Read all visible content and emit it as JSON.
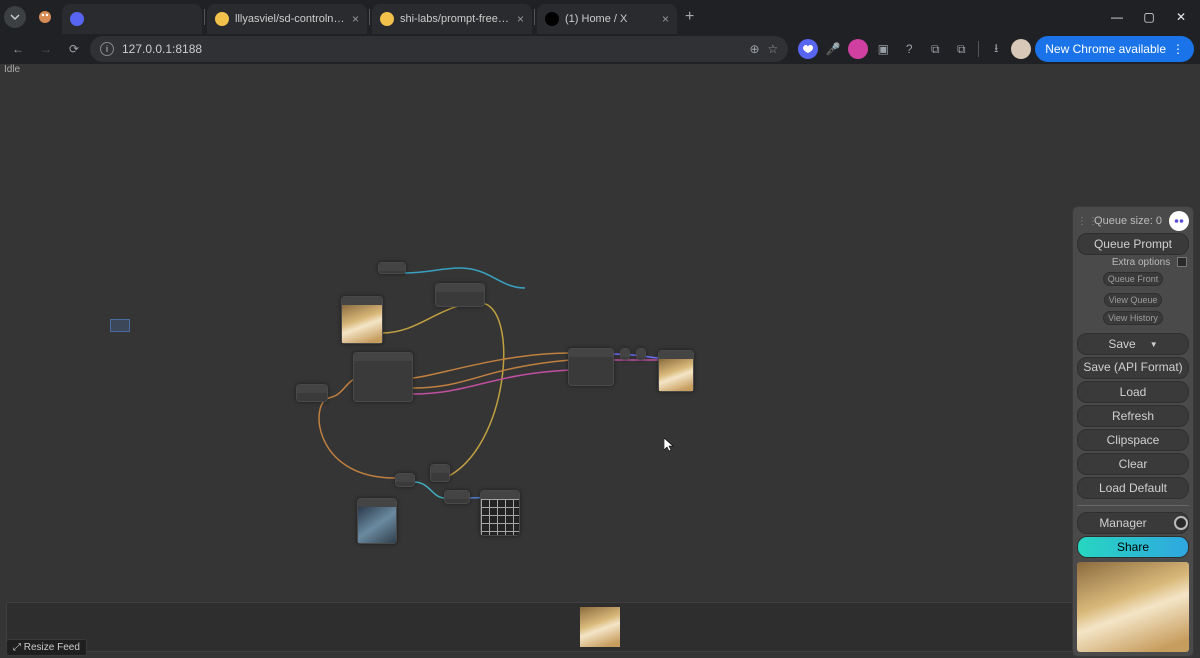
{
  "browser": {
    "tabs": [
      {
        "title": "",
        "favicon": "#5865f2"
      },
      {
        "title": "lllyasviel/sd-controlnet-s…",
        "favicon": "#f2c14b"
      },
      {
        "title": "shi-labs/prompt-free-diffu…",
        "favicon": "#f2c14b"
      },
      {
        "title": "(1) Home / X",
        "favicon": "#ffffff"
      }
    ],
    "url": "127.0.0.1:8188",
    "update_label": "New Chrome available"
  },
  "app": {
    "status": "Idle",
    "resize_feed_label": "⤢ Resize Feed"
  },
  "panel": {
    "queue_size_label": "Queue size:",
    "queue_size_value": "0",
    "queue_prompt": "Queue Prompt",
    "extra_options": "Extra options",
    "queue_front": "Queue Front",
    "view_queue": "View Queue",
    "view_history": "View History",
    "save": "Save",
    "save_api": "Save (API Format)",
    "load": "Load",
    "refresh": "Refresh",
    "clipspace": "Clipspace",
    "clear": "Clear",
    "load_default": "Load Default",
    "manager": "Manager",
    "share": "Share"
  }
}
